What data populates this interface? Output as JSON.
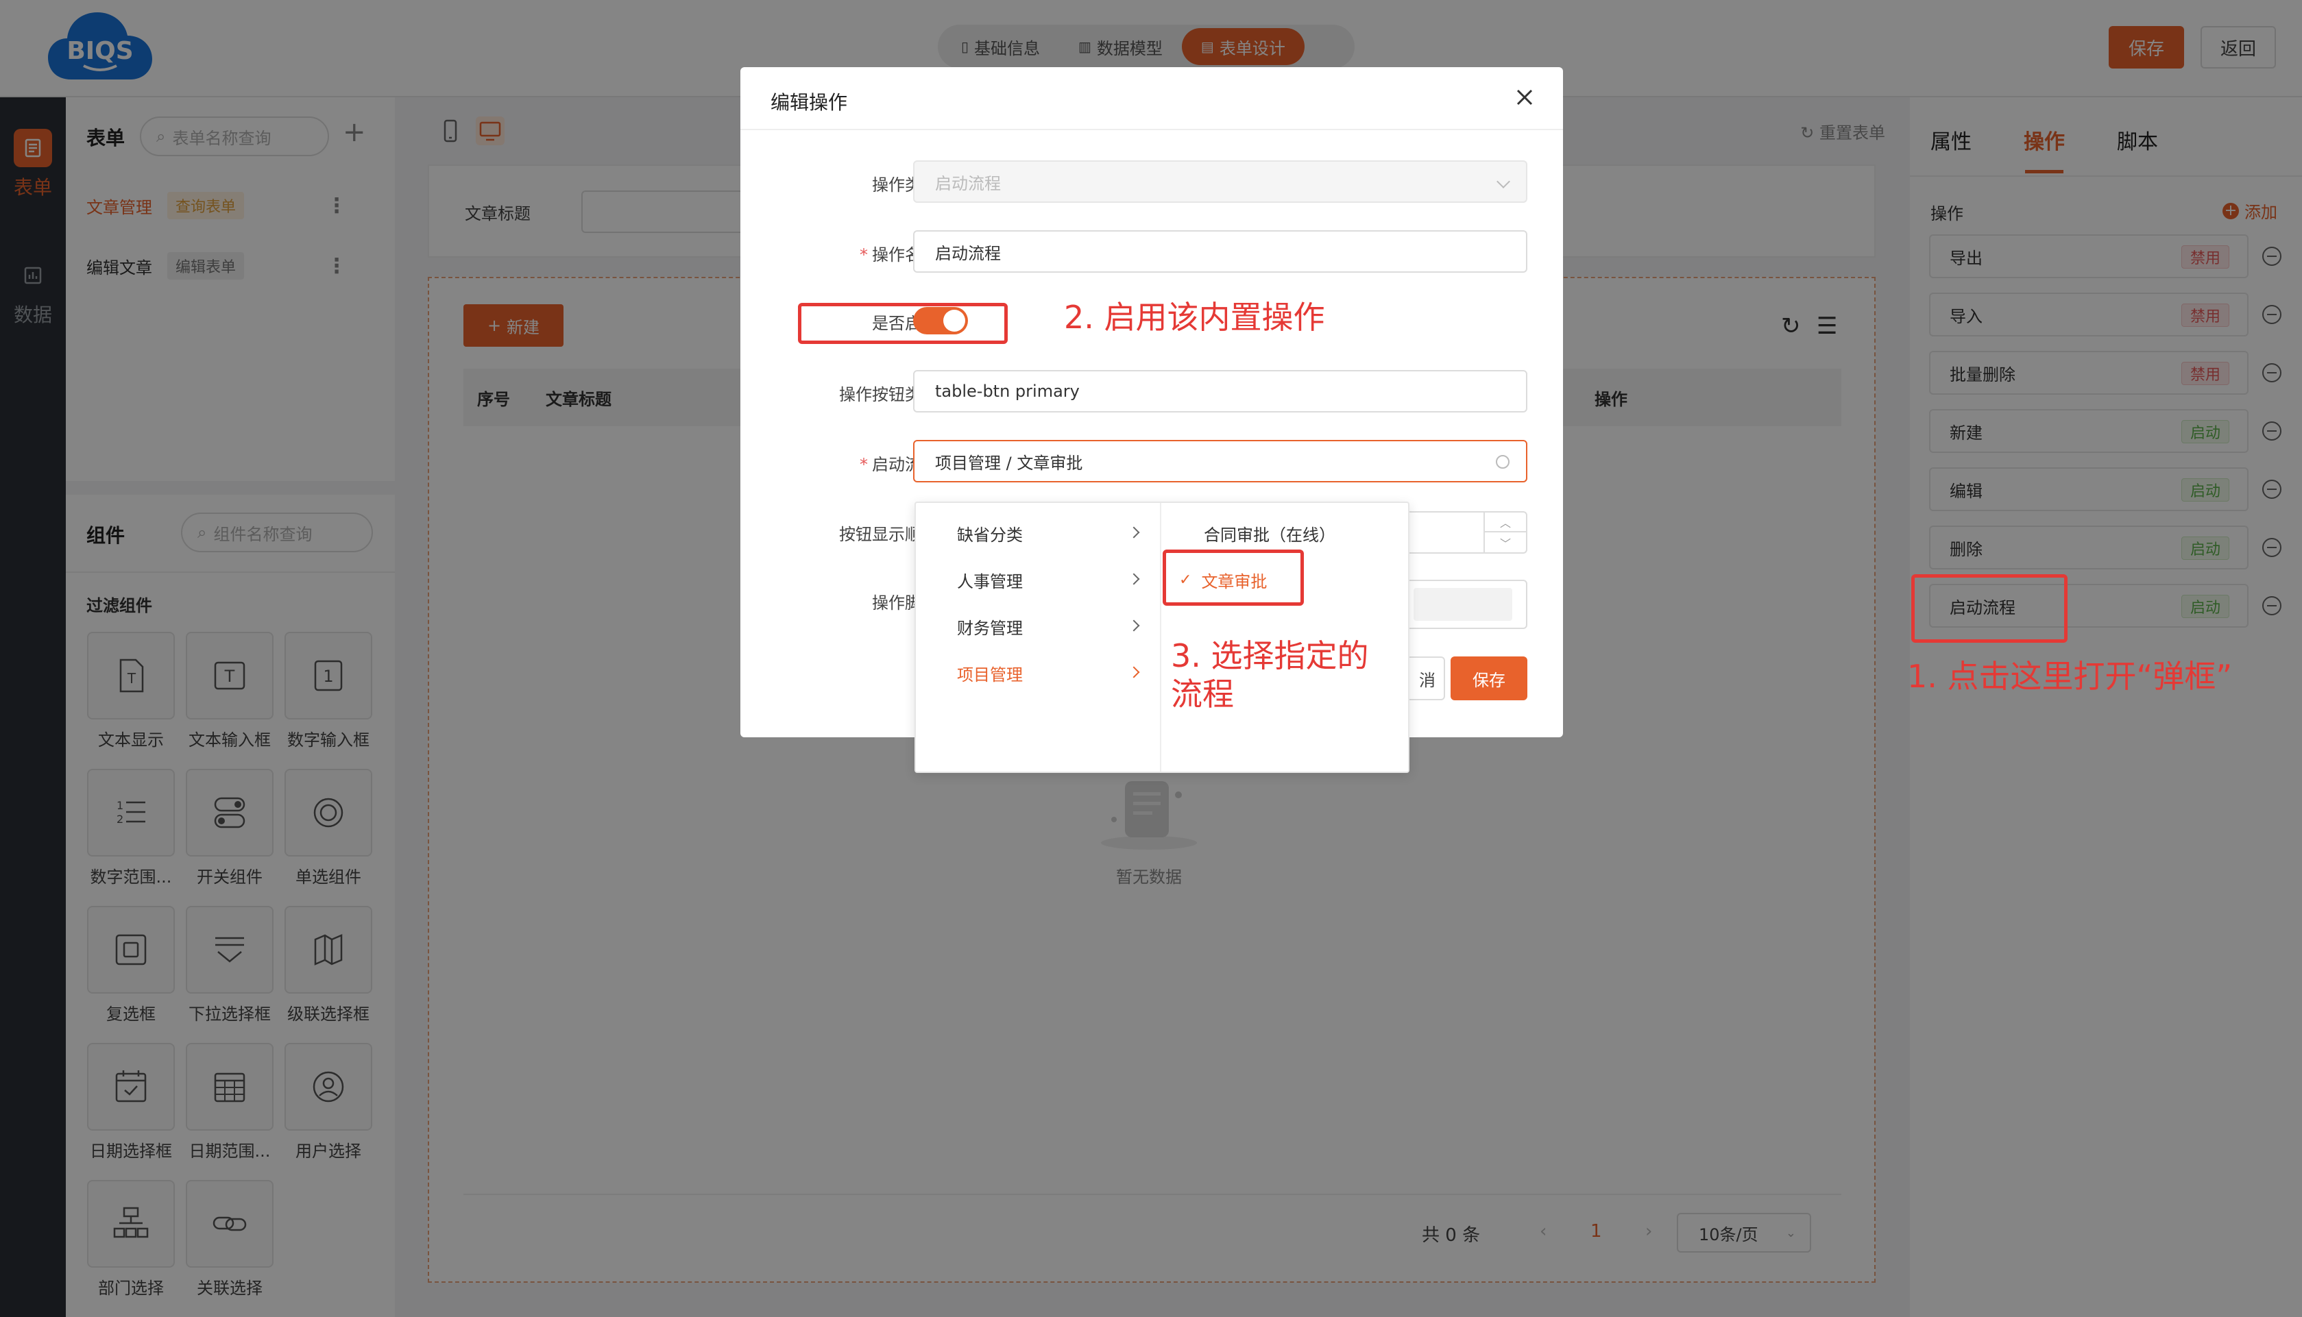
{
  "topbar": {
    "logo_text": "BIQS",
    "tabs": [
      {
        "label": "基础信息",
        "icon": "document-icon",
        "active": false
      },
      {
        "label": "数据模型",
        "icon": "bar-chart-icon",
        "active": false
      },
      {
        "label": "表单设计",
        "icon": "form-icon",
        "active": true
      }
    ],
    "save_label": "保存",
    "back_label": "返回"
  },
  "leftnav": {
    "items": [
      {
        "label": "表单",
        "icon": "form-list-icon",
        "active": true
      },
      {
        "label": "数据",
        "icon": "chart-icon",
        "active": false
      }
    ]
  },
  "formlist": {
    "title": "表单",
    "search_placeholder": "表单名称查询",
    "items": [
      {
        "name": "文章管理",
        "tag": "查询表单",
        "active": true
      },
      {
        "name": "编辑文章",
        "tag": "编辑表单",
        "active": false
      }
    ]
  },
  "components": {
    "title": "组件",
    "search_placeholder": "组件名称查询",
    "group_title": "过滤组件",
    "items": [
      {
        "label": "文本显示",
        "icon": "text-display-icon"
      },
      {
        "label": "文本输入框",
        "icon": "text-input-icon"
      },
      {
        "label": "数字输入框",
        "icon": "number-input-icon"
      },
      {
        "label": "数字范围...",
        "icon": "number-range-icon"
      },
      {
        "label": "开关组件",
        "icon": "switch-icon"
      },
      {
        "label": "单选组件",
        "icon": "radio-icon"
      },
      {
        "label": "复选框",
        "icon": "checkbox-icon"
      },
      {
        "label": "下拉选择框",
        "icon": "dropdown-icon"
      },
      {
        "label": "级联选择框",
        "icon": "cascader-icon"
      },
      {
        "label": "日期选择框",
        "icon": "date-icon"
      },
      {
        "label": "日期范围...",
        "icon": "date-range-icon"
      },
      {
        "label": "用户选择",
        "icon": "user-icon"
      },
      {
        "label": "部门选择",
        "icon": "org-chart-icon"
      },
      {
        "label": "关联选择",
        "icon": "link-icon"
      }
    ]
  },
  "canvas": {
    "reset_label": "重置表单",
    "filter_label": "文章标题",
    "new_button": "新建",
    "columns": [
      "序号",
      "文章标题",
      "操作"
    ],
    "empty_text": "暂无数据",
    "pager": {
      "total": "共 0 条",
      "current": "1",
      "page_size": "10条/页"
    }
  },
  "rightpanel": {
    "tabs": [
      "属性",
      "操作",
      "脚本"
    ],
    "active_tab": "操作",
    "ops_title": "操作",
    "add_label": "添加",
    "operations": [
      {
        "name": "导出",
        "status": "禁用",
        "enabled": false
      },
      {
        "name": "导入",
        "status": "禁用",
        "enabled": false
      },
      {
        "name": "批量删除",
        "status": "禁用",
        "enabled": false
      },
      {
        "name": "新建",
        "status": "启动",
        "enabled": true
      },
      {
        "name": "编辑",
        "status": "启动",
        "enabled": true
      },
      {
        "name": "删除",
        "status": "启动",
        "enabled": true
      },
      {
        "name": "启动流程",
        "status": "启动",
        "enabled": true
      }
    ]
  },
  "dialog": {
    "title": "编辑操作",
    "fields": {
      "op_type_label": "操作类型",
      "op_type_value": "启动流程",
      "op_name_label": "操作名称",
      "op_name_value": "启动流程",
      "enabled_label": "是否启用",
      "btn_class_label": "操作按钮类名",
      "btn_class_value": "table-btn primary",
      "flow_label": "启动流程",
      "flow_value": "项目管理 / 文章审批",
      "order_label": "按钮显示顺序",
      "script_label": "操作脚本"
    },
    "cancel_label": "消",
    "save_label": "保存",
    "cascader": {
      "level1": [
        {
          "label": "缺省分类",
          "active": false
        },
        {
          "label": "人事管理",
          "active": false
        },
        {
          "label": "财务管理",
          "active": false
        },
        {
          "label": "项目管理",
          "active": true
        }
      ],
      "level2": [
        {
          "label": "合同审批（在线）",
          "checked": false
        },
        {
          "label": "文章审批",
          "checked": true
        }
      ]
    }
  },
  "annotations": {
    "step1": "1. 点击这里打开“弹框”",
    "step2": "2. 启用该内置操作",
    "step3_line1": "3. 选择指定的",
    "step3_line2": "流程"
  },
  "colors": {
    "accent": "#e8622c",
    "annotation": "#e53935"
  }
}
